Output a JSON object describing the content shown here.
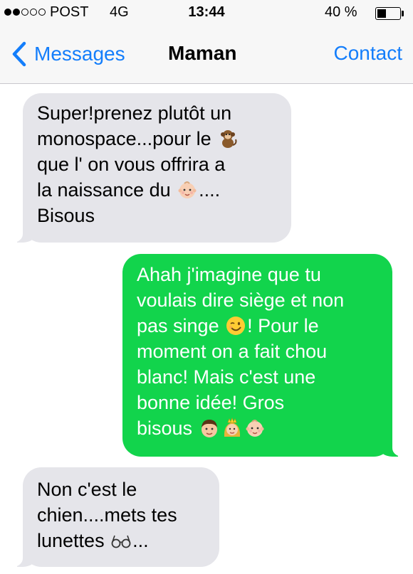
{
  "status_bar": {
    "carrier": "POST",
    "network": "4G",
    "time": "13:44",
    "battery_text": "40 %",
    "battery_level": 0.4,
    "signal_bars_filled": 2,
    "signal_bars_total": 5
  },
  "nav": {
    "back_label": "Messages",
    "title": "Maman",
    "action_label": "Contact"
  },
  "colors": {
    "accent": "#147efb",
    "incoming_bubble": "#e5e5ea",
    "outgoing_bubble": "#12d44c"
  },
  "messages": [
    {
      "direction": "incoming",
      "lines": [
        [
          "Super!prenez plutôt un"
        ],
        [
          "monospace...pour le ",
          "monkey-emoji"
        ],
        [
          "que l' on vous offrira a"
        ],
        [
          "la naissance du ",
          "baby-emoji",
          "...."
        ],
        [
          "Bisous"
        ]
      ]
    },
    {
      "direction": "outgoing",
      "lines": [
        [
          "Ahah j'imagine que tu"
        ],
        [
          "voulais dire siège et non"
        ],
        [
          "pas singe ",
          "wink-emoji",
          "! Pour le"
        ],
        [
          "moment on a fait chou"
        ],
        [
          "blanc! Mais c'est une"
        ],
        [
          "bonne idée! Gros"
        ],
        [
          "bisous ",
          "man-emoji",
          "princess-emoji",
          "baby-emoji"
        ]
      ]
    },
    {
      "direction": "incoming",
      "lines": [
        [
          "Non c'est le"
        ],
        [
          "chien....mets tes"
        ],
        [
          "lunettes ",
          "eyeglasses-emoji",
          "..."
        ]
      ]
    }
  ]
}
